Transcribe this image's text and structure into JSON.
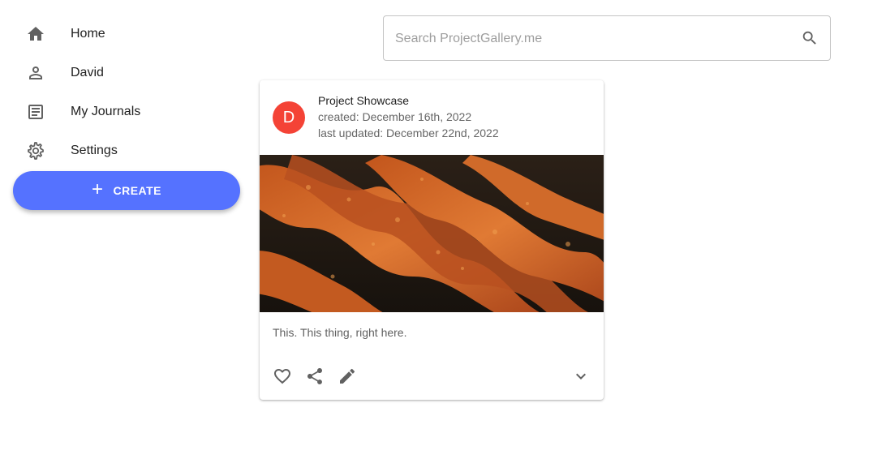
{
  "sidebar": {
    "items": [
      {
        "label": "Home",
        "icon": "home-icon"
      },
      {
        "label": "David",
        "icon": "person-icon"
      },
      {
        "label": "My Journals",
        "icon": "journal-icon"
      },
      {
        "label": "Settings",
        "icon": "gear-icon"
      }
    ],
    "create_label": "CREATE"
  },
  "search": {
    "placeholder": "Search ProjectGallery.me"
  },
  "card": {
    "avatar_letter": "D",
    "title": "Project Showcase",
    "created": "created: December 16th, 2022",
    "updated": "last updated: December 22nd, 2022",
    "body": "This. This thing, right here.",
    "actions": [
      "heart-icon",
      "share-icon",
      "edit-icon",
      "chevron-down-icon"
    ]
  },
  "colors": {
    "accent": "#5572ff",
    "avatar": "#f44336"
  }
}
